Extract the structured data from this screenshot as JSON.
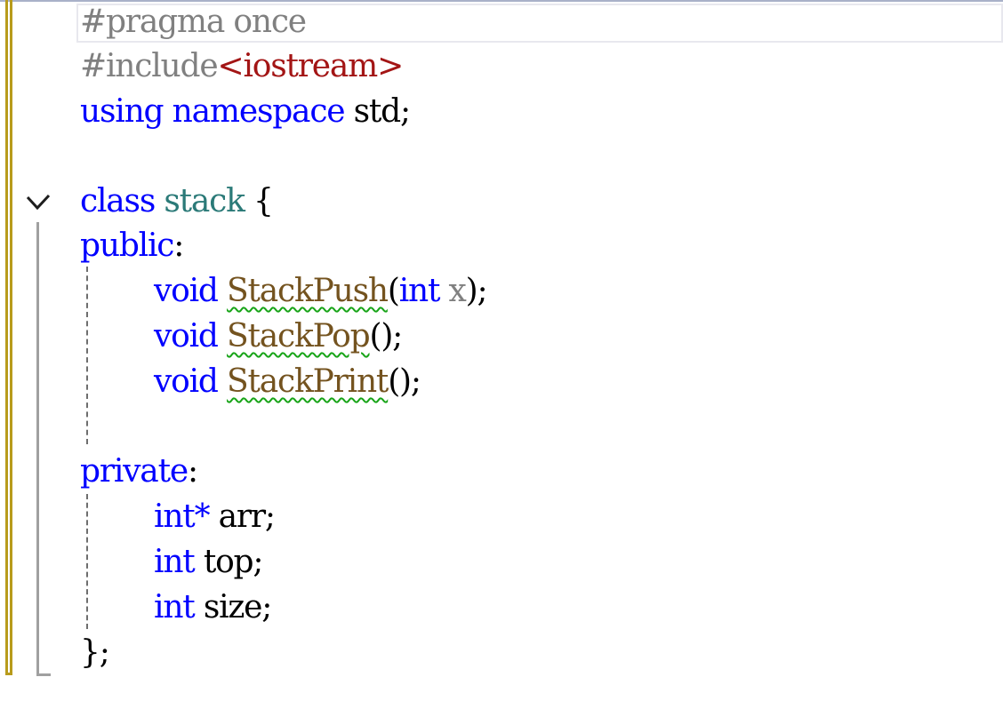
{
  "editor": {
    "lines": [
      {
        "directive": "#pragma",
        "arg": " once"
      },
      {
        "directive": "#include",
        "arg": "<iostream>"
      },
      {
        "kw1": "using",
        "kw2": " namespace",
        "name": " std",
        "end": ";"
      },
      {},
      {
        "kw": "class",
        "name": " stack",
        "brace": " {"
      },
      {
        "label": "public",
        "colon": ":"
      },
      {
        "ret": "void",
        "fn": "StackPush",
        "open": "(",
        "ptype": "int",
        "pname": " x",
        "close": ");"
      },
      {
        "ret": "void",
        "fn": "StackPop",
        "rest": "();"
      },
      {
        "ret": "void",
        "fn": "StackPrint",
        "rest": "();"
      },
      {},
      {
        "label": "private",
        "colon": ":"
      },
      {
        "type": "int*",
        "name": " arr",
        "end": ";"
      },
      {
        "type": "int",
        "name": " top",
        "end": ";"
      },
      {
        "type": "int",
        "name": " size",
        "end": ";"
      },
      {
        "close": "};"
      }
    ]
  },
  "colors": {
    "keyword": "#0000ff",
    "preprocessor": "#808080",
    "string": "#a31515",
    "class_name": "#2b7a78",
    "function_name": "#74531f",
    "squiggle": "#18a418",
    "change_bar": "#b89b1c"
  },
  "icons": {
    "fold": "chevron-down-icon"
  }
}
